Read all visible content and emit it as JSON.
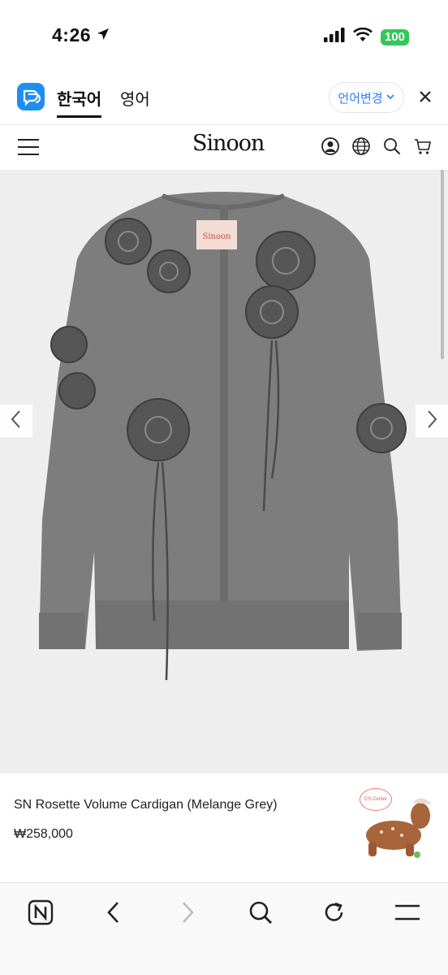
{
  "status_bar": {
    "time": "4:26",
    "battery": "100",
    "icons": [
      "location-arrow-icon",
      "signal-icon",
      "wifi-icon",
      "battery-icon"
    ]
  },
  "translate_bar": {
    "tab_active": "한국어",
    "tab_other": "영어",
    "change_language": "언어변경",
    "icons": [
      "translate-app-icon",
      "chevron-down-icon",
      "close-icon"
    ]
  },
  "site_header": {
    "logo": "Sinoon",
    "icons": [
      "hamburger-menu-icon",
      "user-icon",
      "globe-icon",
      "search-icon",
      "cart-icon"
    ]
  },
  "product": {
    "image_label": "Sinoon",
    "name": "SN Rosette Volume Cardigan (Melange Grey)",
    "price": "₩258,000"
  },
  "cs_widget": {
    "bubble": "CS Center"
  },
  "browser_toolbar": {
    "icons": [
      "naver-home-icon",
      "back-icon",
      "forward-icon",
      "search-icon",
      "refresh-icon",
      "menu-icon"
    ]
  },
  "colors": {
    "accent_blue": "#2e7cf6",
    "battery_green": "#34c759",
    "image_bg": "#eeeeee",
    "sweater_grey": "#7d7d7d"
  }
}
